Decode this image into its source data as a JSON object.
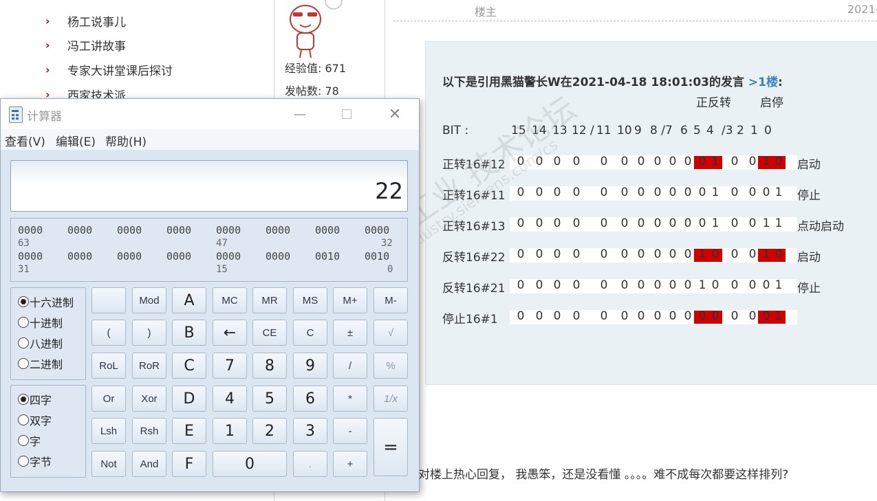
{
  "sidebar": {
    "items": [
      {
        "label": "杨工说事儿"
      },
      {
        "label": "冯工讲故事"
      },
      {
        "label": "专家大讲堂课后探讨"
      },
      {
        "label": "西家技术派"
      }
    ]
  },
  "user": {
    "exp_label": "经验值: 671",
    "posts_label": "发帖数: 78"
  },
  "post": {
    "floor_label": "楼主",
    "date_partial": "2021-",
    "quote_prefix": "以下是引用",
    "quote_user": "黑猫警长W",
    "quote_mid": "在2021-04-18 18:01:03的发言",
    "quote_floor": ">1楼",
    "quote_colon": ":",
    "col_forward_reverse": "正反转",
    "col_start_stop": "启停",
    "bit_label": "BIT :",
    "bit_header": [
      "15",
      "14",
      "13",
      "12 /",
      "11",
      "10",
      "9",
      "8 /",
      "7",
      "6",
      "5",
      "4",
      "/3",
      "2",
      "1",
      "0"
    ],
    "rows": [
      {
        "label": "正转16#12",
        "bits": [
          "0",
          "0",
          "0",
          "0",
          "0",
          "0",
          "0",
          "0",
          "0",
          "0",
          "0",
          "1",
          "0",
          "0",
          "1",
          "0"
        ],
        "note": "启动"
      },
      {
        "label": "正转16#11",
        "bits": [
          "0",
          "0",
          "0",
          "0",
          "0",
          "0",
          "0",
          "0",
          "0",
          "0",
          "0",
          "1",
          "0",
          "0",
          "0",
          "1"
        ],
        "note": "停止"
      },
      {
        "label": "正转16#13",
        "bits": [
          "0",
          "0",
          "0",
          "0",
          "0",
          "0",
          "0",
          "0",
          "0",
          "0",
          "0",
          "1",
          "0",
          "0",
          "1",
          "1"
        ],
        "note": "点动启动"
      },
      {
        "label": "反转16#22",
        "bits": [
          "0",
          "0",
          "0",
          "0",
          "0",
          "0",
          "0",
          "0",
          "0",
          "0",
          "1",
          "0",
          "0",
          "0",
          "1",
          "0"
        ],
        "note": "启动"
      },
      {
        "label": "反转16#21",
        "bits": [
          "0",
          "0",
          "0",
          "0",
          "0",
          "0",
          "0",
          "0",
          "0",
          "0",
          "1",
          "0",
          "0",
          "0",
          "0",
          "1"
        ],
        "note": "停止"
      },
      {
        "label": "停止16#1",
        "bits": [
          "0",
          "0",
          "0",
          "0",
          "0",
          "0",
          "0",
          "0",
          "0",
          "0",
          "0",
          "0",
          "0",
          "0",
          "0",
          "1"
        ],
        "note": ""
      }
    ],
    "highlight_color": "#d10000",
    "reply_text": "对楼上热心回复， 我愚笨，还是没看懂 。。。。难不成每次都要这样排列?",
    "watermark": "西门子工业 技术论坛",
    "watermark_url": "support.industry.siemens.com/cs"
  },
  "calculator": {
    "title": "计算器",
    "menu": [
      "查看(V)",
      "编辑(E)",
      "帮助(H)"
    ],
    "display_value": "22",
    "binary": {
      "row1": [
        "0000",
        "0000",
        "0000",
        "0000",
        "0000",
        "0000",
        "0000",
        "0000"
      ],
      "row2": [
        "0000",
        "0000",
        "0000",
        "0000",
        "0000",
        "0000",
        "0010",
        "0010"
      ],
      "pos1": [
        "63",
        "47",
        "32"
      ],
      "pos2": [
        "31",
        "15",
        "0"
      ]
    },
    "base_options": [
      "十六进制",
      "十进制",
      "八进制",
      "二进制"
    ],
    "base_selected": "十六进制",
    "word_options": [
      "四字",
      "双字",
      "字",
      "字节"
    ],
    "word_selected": "四字",
    "keys": {
      "mod": "Mod",
      "a": "A",
      "mc": "MC",
      "mr": "MR",
      "ms": "MS",
      "mplus": "M+",
      "mminus": "M-",
      "lparen": "(",
      "rparen": ")",
      "b": "B",
      "back": "←",
      "ce": "CE",
      "c": "C",
      "plusminus": "±",
      "sqrt": "√",
      "rol": "RoL",
      "ror": "RoR",
      "hc": "C",
      "n7": "7",
      "n8": "8",
      "n9": "9",
      "div": "/",
      "pct": "%",
      "or": "Or",
      "xor": "Xor",
      "d": "D",
      "n4": "4",
      "n5": "5",
      "n6": "6",
      "mul": "*",
      "recip": "1/x",
      "lsh": "Lsh",
      "rsh": "Rsh",
      "e": "E",
      "n1": "1",
      "n2": "2",
      "n3": "3",
      "sub": "-",
      "eq": "=",
      "not": "Not",
      "and": "And",
      "f": "F",
      "n0": "0",
      "dot": ".",
      "add": "+"
    }
  }
}
